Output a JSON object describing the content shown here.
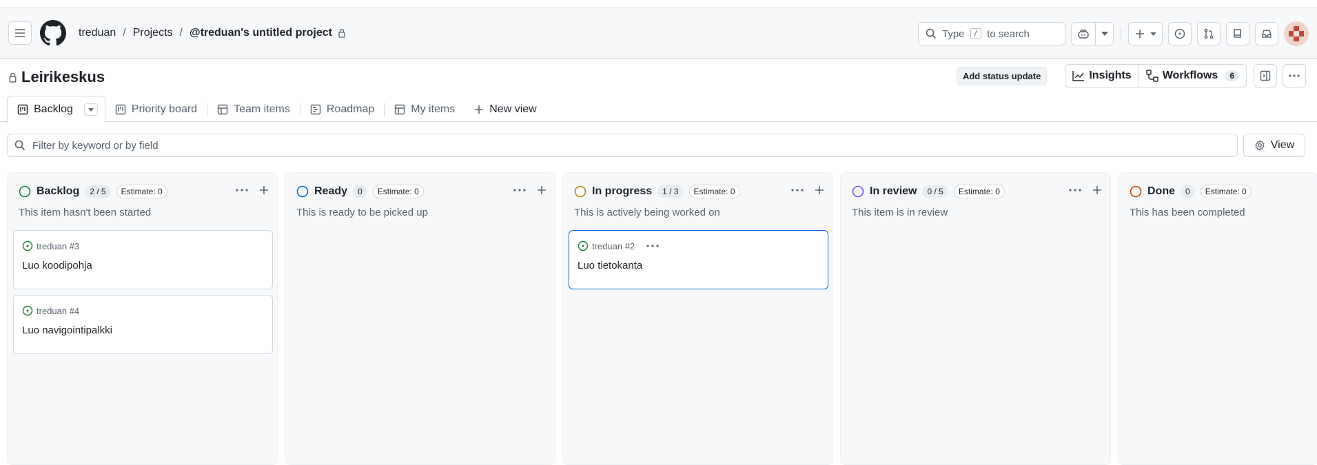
{
  "nav": {
    "breadcrumbs": [
      "treduan",
      "Projects",
      "@treduan's untitled project"
    ],
    "separator": "/",
    "search_placeholder_before": "Type",
    "search_key": "/",
    "search_placeholder_after": "to search"
  },
  "project": {
    "title": "Leirikeskus",
    "status_button": "Add status update",
    "insights_label": "Insights",
    "workflows_label": "Workflows",
    "workflows_count": "6"
  },
  "tabs": [
    {
      "label": "Backlog",
      "icon": "board-icon",
      "active": true
    },
    {
      "label": "Priority board",
      "icon": "board-icon"
    },
    {
      "label": "Team items",
      "icon": "table-icon"
    },
    {
      "label": "Roadmap",
      "icon": "roadmap-icon"
    },
    {
      "label": "My items",
      "icon": "table-icon"
    },
    {
      "label": "New view",
      "icon": "plus-icon"
    }
  ],
  "filter": {
    "placeholder": "Filter by keyword or by field",
    "view_label": "View"
  },
  "columns": [
    {
      "name": "Backlog",
      "count": "2 / 5",
      "estimate": "Estimate: 0",
      "description": "This item hasn't been started",
      "color": "#1a7f37",
      "cards": [
        {
          "ref": "treduan #3",
          "title": "Luo koodipohja"
        },
        {
          "ref": "treduan #4",
          "title": "Luo navigointipalkki"
        }
      ]
    },
    {
      "name": "Ready",
      "count": "0",
      "estimate": "Estimate: 0",
      "description": "This is ready to be picked up",
      "color": "#0969da",
      "cards": []
    },
    {
      "name": "In progress",
      "count": "1 / 3",
      "estimate": "Estimate: 0",
      "description": "This is actively being worked on",
      "color": "#bf8700",
      "cards": [
        {
          "ref": "treduan #2",
          "title": "Luo tietokanta"
        }
      ]
    },
    {
      "name": "In review",
      "count": "0 / 5",
      "estimate": "Estimate: 0",
      "description": "This item is in review",
      "color": "#8250df",
      "cards": []
    },
    {
      "name": "Done",
      "count": "0",
      "estimate": "Estimate: 0",
      "description": "This has been completed",
      "color": "#bc4c00",
      "cards": []
    }
  ]
}
